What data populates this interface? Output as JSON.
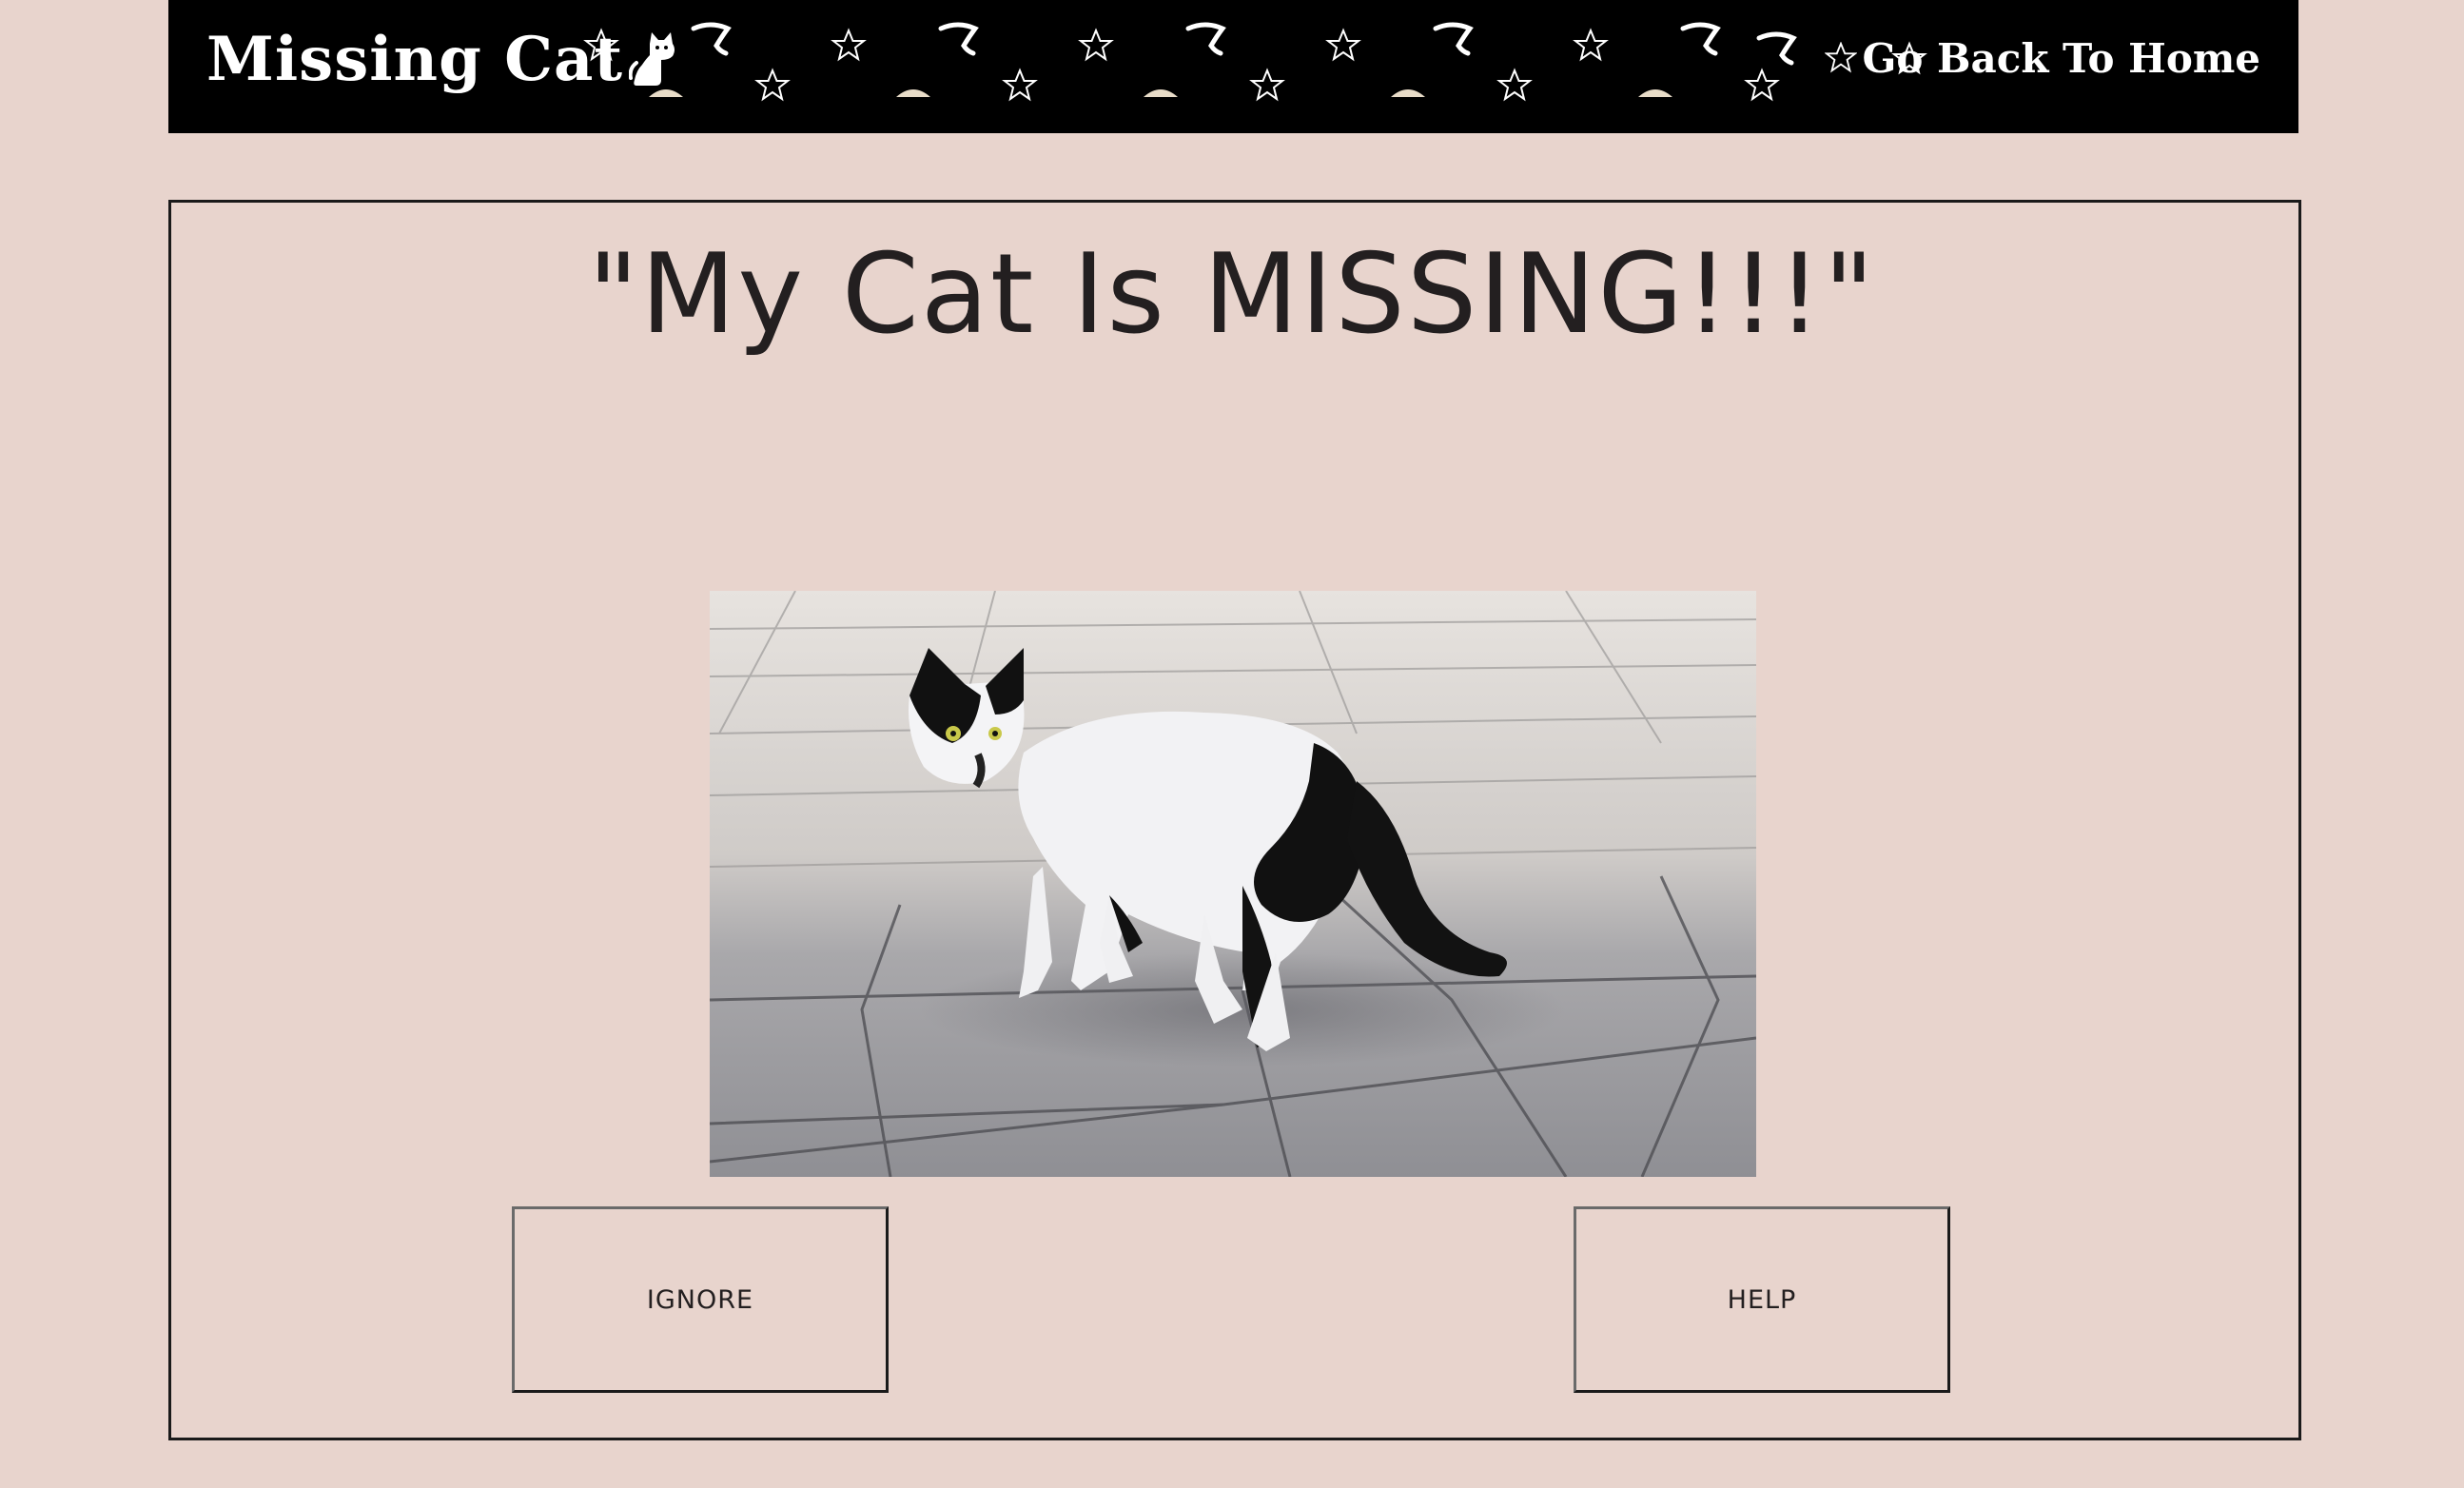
{
  "header": {
    "logo_text": "Missing Cat",
    "logo_icon": "cat-icon",
    "home_link_label": "Go Back To Home",
    "home_link_icon": "star-icon",
    "background_color": "#000000",
    "pattern_icons": [
      "star-icon",
      "moon-icon"
    ]
  },
  "main": {
    "title": "\"My Cat Is MISSING!!!\"",
    "photo_subject": "black-and-white cat on tiled pavement",
    "buttons": {
      "ignore_label": "IGNORE",
      "help_label": "HELP"
    }
  },
  "colors": {
    "page_background": "#e8d4cd",
    "text": "#231f20"
  }
}
